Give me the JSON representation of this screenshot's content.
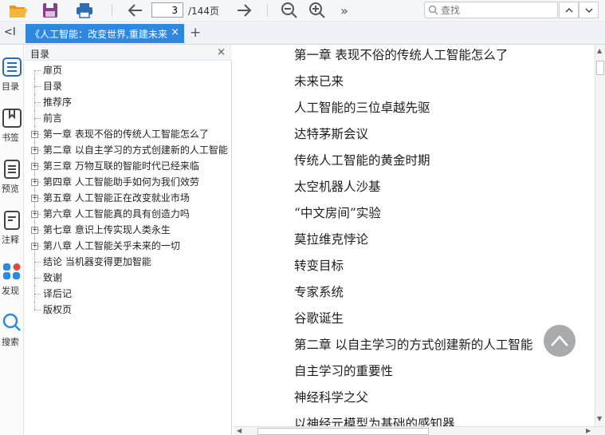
{
  "toolbar": {
    "page_current": "3",
    "page_total": "/144页",
    "more": "»",
    "search_placeholder": "查找"
  },
  "tab": {
    "title": "《人工智能：改变世界,重建未来",
    "close": "×"
  },
  "rail": {
    "items": [
      {
        "label": "目录",
        "icon": "toc-list-icon"
      },
      {
        "label": "书签",
        "icon": "bookmark-icon"
      },
      {
        "label": "预览",
        "icon": "preview-icon"
      },
      {
        "label": "注释",
        "icon": "annotation-icon"
      },
      {
        "label": "发现",
        "icon": "discover-icon"
      },
      {
        "label": "搜索",
        "icon": "search-icon"
      }
    ],
    "collapse": "<I"
  },
  "toc": {
    "title": "目录",
    "close": "×",
    "items": [
      {
        "label": "扉页",
        "expandable": false
      },
      {
        "label": "目录",
        "expandable": false
      },
      {
        "label": "推荐序",
        "expandable": false
      },
      {
        "label": "前言",
        "expandable": false
      },
      {
        "label": "第一章 表现不俗的传统人工智能怎么了",
        "expandable": true
      },
      {
        "label": "第二章 以自主学习的方式创建新的人工智能",
        "expandable": true
      },
      {
        "label": "第三章 万物互联的智能时代已经来临",
        "expandable": true
      },
      {
        "label": "第四章 人工智能助手如何为我们效劳",
        "expandable": true
      },
      {
        "label": "第五章 人工智能正在改变就业市场",
        "expandable": true
      },
      {
        "label": "第六章 人工智能真的具有创造力吗",
        "expandable": true
      },
      {
        "label": "第七章 意识上传实现人类永生",
        "expandable": true
      },
      {
        "label": "第八章 人工智能关乎未来的一切",
        "expandable": true
      },
      {
        "label": "结论 当机器变得更加智能",
        "expandable": false
      },
      {
        "label": "致谢",
        "expandable": false
      },
      {
        "label": "译后记",
        "expandable": false
      },
      {
        "label": "版权页",
        "expandable": false
      }
    ]
  },
  "content": {
    "lines": [
      "第一章 表现不俗的传统人工智能怎么了",
      "未来已来",
      "人工智能的三位卓越先驱",
      "达特茅斯会议",
      "传统人工智能的黄金时期",
      "太空机器人沙基",
      "“中文房间”实验",
      "莫拉维克悖论",
      "转变目标",
      "专家系统",
      "谷歌诞生",
      "第二章 以自主学习的方式创建新的人工智能",
      "自主学习的重要性",
      "神经科学之父",
      "以神经元模型为基础的感知器"
    ]
  },
  "colors": {
    "accent": "#2e88e0",
    "toolbar_icon": "#2b6cb4",
    "save_icon": "#8a3d8f",
    "open_folder": "#f0a81e"
  }
}
